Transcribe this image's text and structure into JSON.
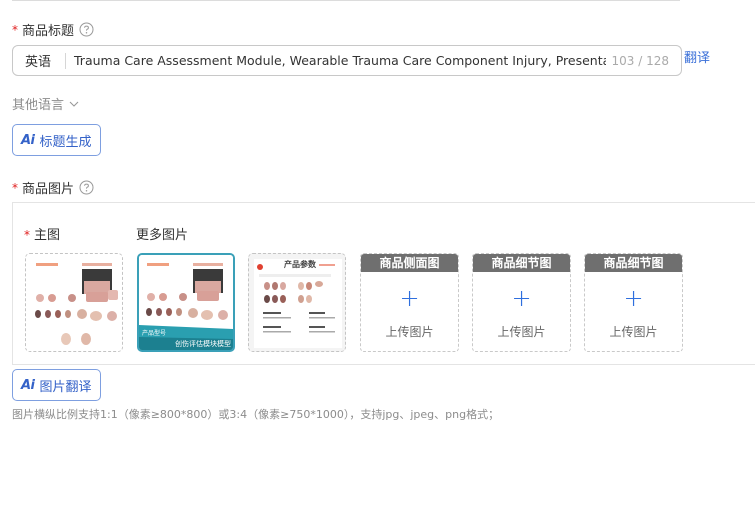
{
  "product_title": {
    "label": "商品标题",
    "language": "英语",
    "value": "Trauma Care Assessment Module, Wearable Trauma Care Component Injury, Presentation",
    "char_count": "103 / 128",
    "translate_label": "翻译"
  },
  "other_languages": {
    "label": "其他语言"
  },
  "title_generate_button": {
    "ai": "Ai",
    "label": "标题生成"
  },
  "product_images": {
    "label": "商品图片",
    "main_image_label": "主图",
    "more_images_label": "更多图片",
    "thumbnails": [
      {
        "caption": "",
        "banner": ""
      },
      {
        "caption": "产品型号",
        "banner": "创伤评估模块模型"
      },
      {
        "caption": "产品参数",
        "banner": ""
      }
    ],
    "upload_slots": [
      {
        "header": "商品侧面图",
        "text": "上传图片"
      },
      {
        "header": "商品细节图",
        "text": "上传图片"
      },
      {
        "header": "商品细节图",
        "text": "上传图片"
      }
    ]
  },
  "image_translate_button": {
    "ai": "Ai",
    "label": "图片翻译"
  },
  "hint": "图片横纵比例支持1:1（像素≥800*800）或3:4（像素≥750*1000），支持jpg、jpeg、png格式；",
  "colors": {
    "accent": "#3462c8",
    "required": "#e02020",
    "teal": "#3aa0b8"
  }
}
